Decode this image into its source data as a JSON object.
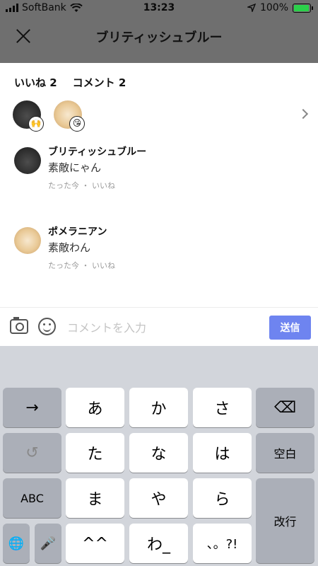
{
  "status_bar": {
    "carrier": "SoftBank",
    "time": "13:23",
    "battery": "100%",
    "battery_level": 1.0
  },
  "header": {
    "title": "ブリティッシュブルー"
  },
  "summary": {
    "likes": "いいね 2",
    "comments": "コメント 2"
  },
  "comments": [
    {
      "name": "ブリティッシュブルー",
      "text": "素敵にゃん",
      "meta": "たった今 ・ いいね"
    },
    {
      "name": "ポメラニアン",
      "text": "素敵わん",
      "meta": "たった今 ・ いいね"
    }
  ],
  "input": {
    "placeholder": "コメントを入力",
    "send_label": "送信"
  },
  "keyboard": {
    "row1": [
      "→",
      "あ",
      "か",
      "さ",
      "⌫"
    ],
    "row2": [
      "↺",
      "た",
      "な",
      "は",
      "空白"
    ],
    "row3": [
      "ABC",
      "ま",
      "や",
      "ら"
    ],
    "row4": [
      "🌐",
      "🎤",
      "^^",
      "わ_",
      "、。?!"
    ],
    "enter": "改行"
  },
  "colors": {
    "send": "#6e84f0",
    "dim": "#6f6f6f",
    "keyboard_bg": "#d2d5db"
  }
}
